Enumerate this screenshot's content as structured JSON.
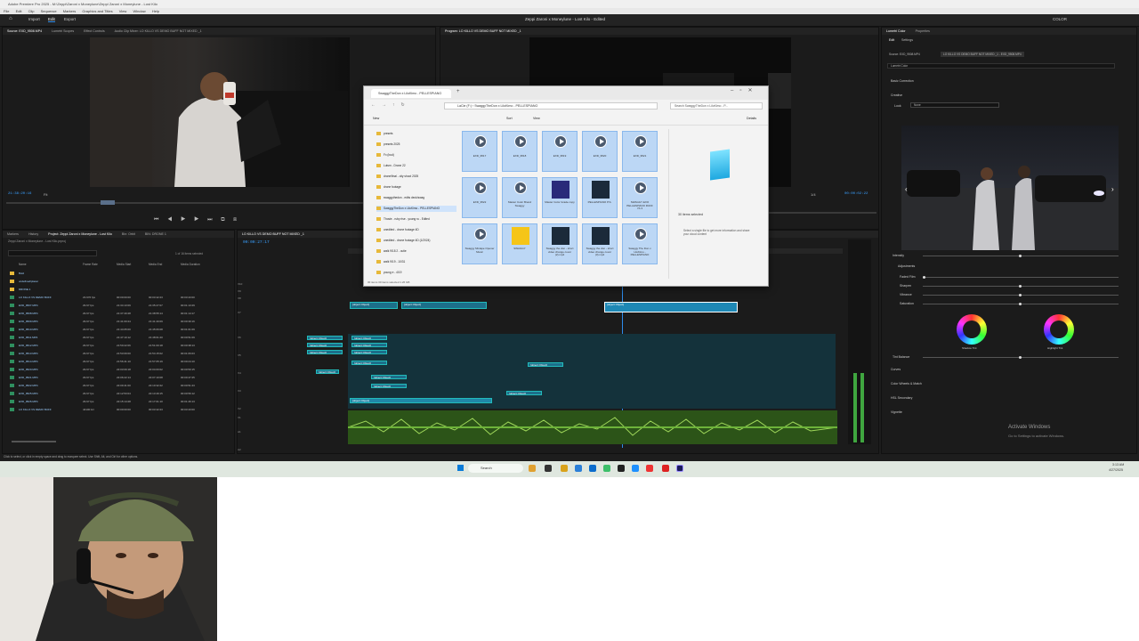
{
  "window": {
    "title": "Adobe Premiere Pro 2025 - M:\\Zeppi\\Zaroni x Moneylune\\Zeppi Zaroni x Moneylune - Lost Kilo",
    "menu": [
      "File",
      "Edit",
      "Clip",
      "Sequence",
      "Markers",
      "Graphics and Titles",
      "View",
      "Window",
      "Help"
    ]
  },
  "workspace": {
    "tabs": [
      "Import",
      "Edit",
      "Export"
    ],
    "active": "Edit",
    "project_title": "Zeppi Zaroni x Moneylune - Lost Kilo - Edited",
    "right": "COLOR"
  },
  "source_monitor": {
    "tabs": [
      "Source: EXD_9508.MP4",
      "Lumetri Scopes",
      "Effect Controls",
      "Audio Clip Mixer: LO KILLO VS DEMO BUFF NOT MIXED _1"
    ],
    "timecode": "21:38:20:16",
    "fit": "Fit"
  },
  "program_monitor": {
    "tab": "Program: LO KILLO VS DEMO BUFF NOT MIXED _1",
    "timecode": "00:00:02:22",
    "fit": "1/4"
  },
  "project_panel": {
    "tabs": [
      "Markers",
      "History",
      "Project: Zeppi Zaroni x Moneylune - Lost Kilo",
      "Bin: Orbit",
      "BIN: DRONE 1"
    ],
    "path": "Zeppi Zaroni x Moneylune - Lost Kilo.prproj",
    "selection": "1 of 16 items selected",
    "columns": [
      "Name",
      "Frame Rate",
      "Media Start",
      "Media End",
      "Media Duration"
    ],
    "items": [
      {
        "name": "Bold",
        "fps": "",
        "start": "",
        "end": "",
        "dur": ""
      },
      {
        "name": "undefined/placer",
        "fps": "",
        "start": "",
        "end": "",
        "dur": ""
      },
      {
        "name": "DRONE 1",
        "fps": "",
        "start": "",
        "end": "",
        "dur": ""
      },
      {
        "name": "LO KILLO VS DEMO BUFF",
        "fps": "23.976 fps",
        "start": "00:00:00:00",
        "end": "00:03:42:23",
        "dur": "00:03:43:00"
      },
      {
        "name": "EXD_9507.MP4",
        "fps": "29.97 fps",
        "start": "21:34:13:09",
        "end": "21:35:27:07",
        "dur": "00:01:13:29"
      },
      {
        "name": "EXD_9508.MP4",
        "fps": "29.97 fps",
        "start": "21:37:40:28",
        "end": "21:38:55:14",
        "dur": "00:01:14:17"
      },
      {
        "name": "EXD_9509.MP4",
        "fps": "29.97 fps",
        "start": "21:41:00:24",
        "end": "21:41:40:09",
        "dur": "00:00:39:16"
      },
      {
        "name": "EXD_9510.MP4",
        "fps": "29.97 fps",
        "start": "21:44:05:00",
        "end": "21:45:06:08",
        "dur": "00:01:01:09"
      },
      {
        "name": "EXD_9511.MP4",
        "fps": "29.97 fps",
        "start": "21:47:10:12",
        "end": "21:48:01:20",
        "dur": "00:00:51:09"
      },
      {
        "name": "EXD_9512.MP4",
        "fps": "29.97 fps",
        "start": "21:50:22:06",
        "end": "21:51:00:18",
        "dur": "00:00:38:13"
      },
      {
        "name": "EXD_9513.MP4",
        "fps": "29.97 fps",
        "start": "21:53:09:00",
        "end": "21:54:15:02",
        "dur": "00:01:06:03"
      },
      {
        "name": "EXD_9514.MP4",
        "fps": "29.97 fps",
        "start": "21:56:41:10",
        "end": "21:57:05:19",
        "dur": "00:00:24:10"
      },
      {
        "name": "EXD_9520.MP4",
        "fps": "29.97 fps",
        "start": "22:03:09:18",
        "end": "22:04:00:02",
        "dur": "00:00:50:15"
      },
      {
        "name": "EXD_9521.MP4",
        "fps": "29.97 fps",
        "start": "22:06:22:14",
        "end": "22:07:10:08",
        "dur": "00:00:47:25"
      },
      {
        "name": "EXD_9522.MP4",
        "fps": "29.97 fps",
        "start": "22:09:41:00",
        "end": "22:10:32:22",
        "dur": "00:00:51:23"
      },
      {
        "name": "EXD_9525.MP4",
        "fps": "29.97 fps",
        "start": "22:12:53:04",
        "end": "22:13:49:15",
        "dur": "00:00:56:12"
      },
      {
        "name": "EXD_9526.MP4",
        "fps": "29.97 fps",
        "start": "22:15:14:28",
        "end": "22:17:01:10",
        "dur": "00:01:46:13"
      },
      {
        "name": "LO KILLO VS DEMO BUFF",
        "fps": "44100 Hz",
        "start": "00:00:00:00",
        "end": "00:03:42:23",
        "dur": "00:03:43:00"
      }
    ]
  },
  "timeline": {
    "tab": "LO KILLO VS DEMO BUFF NOT MIXED _1",
    "timecode": "00:00:27:17",
    "video_tracks": [
      "V10",
      "V9",
      "V8",
      "V7",
      "V6",
      "V5",
      "V4",
      "V3",
      "V2",
      "V1"
    ],
    "audio_tracks": [
      "A1",
      "A2"
    ],
    "clips": [
      {
        "label": "Swaggy Rick"
      },
      {
        "label": "Swaggy Brand by Slendr 2025"
      },
      {
        "label": "EXD_9526.MP4 [V]"
      },
      {
        "label": "EXD_9508.MP4"
      },
      {
        "label": "EXD_9514.MP4"
      },
      {
        "label": "EXD_9513.MP4"
      },
      {
        "label": "EXD_9510.MP4"
      },
      {
        "label": "EXD_9509.MP4"
      },
      {
        "label": "EXD_9507.MP4"
      },
      {
        "label": "EXD_9516.MP4"
      },
      {
        "label": "EXD_9520.MP4"
      },
      {
        "label": "EXD_9521.MP4"
      },
      {
        "label": "EXD_9522.MP4"
      },
      {
        "label": "EXD_9525.MP4"
      },
      {
        "label": "EXD_9512.MP4"
      },
      {
        "label": "EXD_9511.MP4"
      }
    ]
  },
  "explorer": {
    "tab": "SwaggyTheDon x LiloKimo - PELLESPIANO",
    "path": [
      "LaCie (F:)",
      "SwaggyTheDon x LiloKimo - PELLESPIANO"
    ],
    "search": "Search SwaggyTheDon x LiloKimo - P...",
    "toolbar": [
      "New",
      "Sort",
      "View",
      "Details"
    ],
    "nav": [
      "presets",
      "presets 2025",
      "Fx (bud)",
      "Lutsm - Drone 22",
      "drone/final - city shoot 2025",
      "drone footage",
      "swaggythedon - edits deck/swag",
      "SwaggyTheDon x LiloKimo - PELLESPIANO",
      "Thosie - ruby rise - young ru - Edited",
      "unedited - drone footage 4D",
      "unedited - drone footage 4D (1/2024)",
      "walk 9/18 2 - cutie",
      "walk 9/19 - 10/31",
      "young e - 4/19"
    ],
    "files": [
      {
        "name": "EXD_9517",
        "kind": "video"
      },
      {
        "name": "EXD_9518",
        "kind": "video"
      },
      {
        "name": "EXD_9519",
        "kind": "video"
      },
      {
        "name": "EXD_9520",
        "kind": "video"
      },
      {
        "name": "EXD_9521",
        "kind": "video"
      },
      {
        "name": "EXD_9522",
        "kind": "video"
      },
      {
        "name": "Master Color Brand Swaggy",
        "kind": "video"
      },
      {
        "name": "Master Color Grade copy",
        "kind": "premiere"
      },
      {
        "name": "PELLESPIANO P.S.",
        "kind": "image"
      },
      {
        "name": "SWAGGY EXO PELLESPIANO RUFF 7A 3",
        "kind": "video"
      },
      {
        "name": "Swaggy Mixtape Opener Music",
        "kind": "video"
      },
      {
        "name": "SWAGGY",
        "kind": "brand"
      },
      {
        "name": "Swaggy the don - short video change cover (2).mp4",
        "kind": "image"
      },
      {
        "name": "Swaggy the don - short video change cover (3).mp4",
        "kind": "image"
      },
      {
        "name": "Swaggy The Don x LiloKimo - PELLESPIANO",
        "kind": "video"
      }
    ],
    "selected_count": "30 items selected",
    "details_hint": "Select a single file to get more information and share your cloud content",
    "status": "30 items  30 items selected  1.26 GB"
  },
  "lumetri": {
    "tabs": [
      "Lumetri Color",
      "Properties"
    ],
    "subtabs": [
      "Edit",
      "Settings"
    ],
    "source": "Source: EXD_9508.MP4",
    "sequence": "LO KILLO VS DEMO BUFF NOT MIXED _1 - EXD_9508.MP4",
    "preset": "Lumetri Color",
    "sections": [
      "Basic Correction",
      "Creative"
    ],
    "look_label": "Look",
    "look_value": "None",
    "intensity": "Intensity",
    "adjustments": "Adjustments",
    "sliders": [
      "Faded Film",
      "Sharpen",
      "Vibrance",
      "Saturation"
    ],
    "wheels": [
      "Shadow Tint",
      "Highlight Tint"
    ],
    "tint_balance": "Tint Balance",
    "more_sections": [
      "Curves",
      "Color Wheels & Match",
      "HSL Secondary",
      "Vignette"
    ]
  },
  "activate": {
    "title": "Activate Windows",
    "sub": "Go to Settings to activate Windows."
  },
  "status_bar": "Click to select, or click in empty space and drag to marquee select. Use Shift, Alt, and Ctrl for other options.",
  "taskbar": {
    "search": "Search",
    "time": "3:13 AM",
    "date": "4/27/2025"
  },
  "colors": {
    "accent": "#2d8ceb",
    "clip_blue": "#1c6f8a",
    "audio_green": "#5aa832",
    "folder": "#e7b93a"
  }
}
